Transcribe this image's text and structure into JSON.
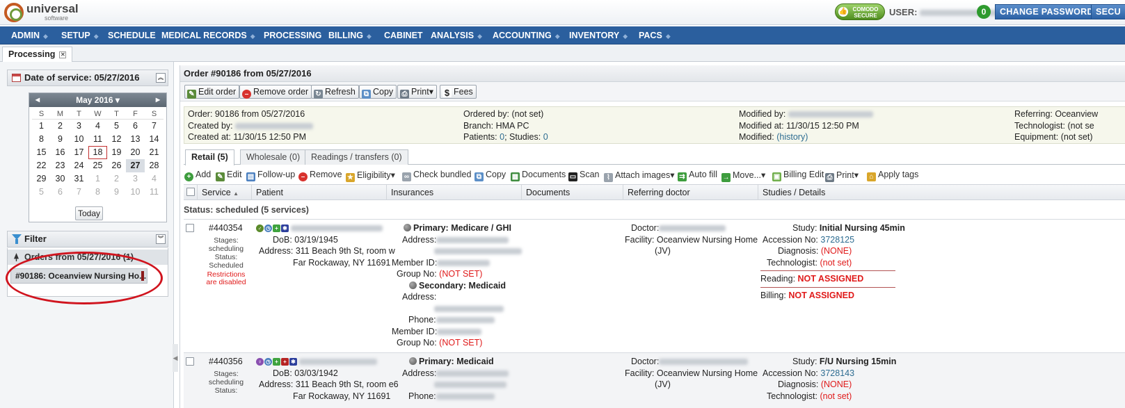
{
  "app": {
    "logo_main": "universal",
    "logo_sub": "software"
  },
  "topbar": {
    "comodo_line1": "COMODO",
    "comodo_line2": "SECURE",
    "user_label": "USER:",
    "notif_count": "0",
    "change_password": "CHANGE PASSWORD",
    "secu": "SECU"
  },
  "menu": [
    {
      "label": "ADMIN",
      "dropdown": true
    },
    {
      "label": "SETUP",
      "dropdown": true
    },
    {
      "label": "SCHEDULE",
      "dropdown": false
    },
    {
      "label": "MEDICAL RECORDS",
      "dropdown": true
    },
    {
      "label": "PROCESSING",
      "dropdown": false
    },
    {
      "label": "BILLING",
      "dropdown": true
    },
    {
      "label": "CABINET",
      "dropdown": false
    },
    {
      "label": "ANALYSIS",
      "dropdown": true
    },
    {
      "label": "ACCOUNTING",
      "dropdown": true
    },
    {
      "label": "INVENTORY",
      "dropdown": true
    },
    {
      "label": "PACS",
      "dropdown": true
    }
  ],
  "page_tab": "Processing",
  "left": {
    "date_of_service": "Date of service: 05/27/2016",
    "calendar": {
      "month": "May 2016 ▾",
      "dow": [
        "S",
        "M",
        "T",
        "W",
        "T",
        "F",
        "S"
      ],
      "weeks": [
        [
          "1",
          "2",
          "3",
          "4",
          "5",
          "6",
          "7"
        ],
        [
          "8",
          "9",
          "10",
          "11",
          "12",
          "13",
          "14"
        ],
        [
          "15",
          "16",
          "17",
          "18",
          "19",
          "20",
          "21"
        ],
        [
          "22",
          "23",
          "24",
          "25",
          "26",
          "27",
          "28"
        ],
        [
          "29",
          "30",
          "31",
          "1",
          "2",
          "3",
          "4"
        ],
        [
          "5",
          "6",
          "7",
          "8",
          "9",
          "10",
          "11"
        ]
      ],
      "today_day": "18",
      "selected_day": "27",
      "today_button": "Today"
    },
    "filter": "Filter",
    "orders_header": "Orders from 05/27/2016 (1)",
    "order_item": "#90186: Oceanview Nursing Ho..."
  },
  "order": {
    "title": "Order #90186 from 05/27/2016",
    "toolbar": [
      "Edit order",
      "Remove order",
      "Refresh",
      "Copy",
      "Print",
      "Fees"
    ],
    "info": {
      "col1": {
        "order_label": "Order:",
        "order_value": "90186 from 05/27/2016",
        "created_by_label": "Created by:",
        "created_at_label": "Created at:",
        "created_at_value": "11/30/15 12:50 PM"
      },
      "col2": {
        "ordered_by_label": "Ordered by:",
        "ordered_by_value": "(not set)",
        "branch_label": "Branch:",
        "branch_value": "HMA PC",
        "patients_label": "Patients:",
        "patients_value": "0",
        "studies_label": "; Studies:",
        "studies_value": "0"
      },
      "col3": {
        "modified_by_label": "Modified by:",
        "modified_at_label": "Modified at:",
        "modified_at_value": "11/30/15 12:50 PM",
        "modified_label": "Modified:",
        "modified_value": "(history)"
      },
      "col4": {
        "referring_label": "Referring:",
        "referring_value": "Oceanview",
        "technologist_label": "Technologist:",
        "technologist_value": "(not se",
        "equipment_label": "Equipment:",
        "equipment_value": "(not set)"
      }
    },
    "tabs": [
      "Retail (5)",
      "Wholesale (0)",
      "Readings / transfers (0)"
    ],
    "actions": [
      "Add",
      "Edit",
      "Follow-up",
      "Remove",
      "Eligibility",
      "Check bundled",
      "Copy",
      "Documents",
      "Scan",
      "Attach images",
      "Auto fill",
      "Move...",
      "Billing Edit",
      "Print",
      "Apply tags"
    ],
    "columns": [
      "Service",
      "Patient",
      "Insurances",
      "Documents",
      "Referring doctor",
      "Studies / Details"
    ],
    "status_group": "Status: scheduled (5 services)",
    "rows": [
      {
        "id": "#440354",
        "stages_label": "Stages:",
        "stages_value": "scheduling",
        "status_label": "Status:",
        "status_value": "Scheduled",
        "restrictions": "Restrictions are disabled",
        "dob_label": "DoB:",
        "dob": "03/19/1945",
        "address_label": "Address:",
        "address1": "311 Beach 9th St, room w",
        "address2": "Far Rockaway, NY 11691",
        "primary": "Primary: Medicare / GHI",
        "ins_address_label": "Address:",
        "member_label": "Member ID:",
        "group_label": "Group No:",
        "group_value": "(NOT SET)",
        "secondary": "Secondary: Medicaid",
        "sec_address_label": "Address:",
        "phone_label": "Phone:",
        "sec_member_label": "Member ID:",
        "sec_group_label": "Group No:",
        "sec_group_value": "(NOT SET)",
        "doctor_label": "Doctor:",
        "facility_label": "Facility:",
        "facility_value": "Oceanview Nursing Home",
        "facility_value2": "(JV)",
        "study_label": "Study:",
        "study_value": "Initial Nursing 45min",
        "accession_label": "Accession No:",
        "accession_value": "3728125",
        "diagnosis_label": "Diagnosis:",
        "diagnosis_value": "(NONE)",
        "technologist_label": "Technologist:",
        "technologist_value": "(not set)",
        "reading_label": "Reading:",
        "reading_value": "NOT ASSIGNED",
        "billing_label": "Billing:",
        "billing_value": "NOT ASSIGNED"
      },
      {
        "id": "#440356",
        "stages_label": "Stages:",
        "stages_value": "scheduling",
        "status_label": "Status:",
        "dob_label": "DoB:",
        "dob": "03/03/1942",
        "address_label": "Address:",
        "address1": "311 Beach 9th St, room e6",
        "address2": "Far Rockaway, NY 11691",
        "primary": "Primary: Medicaid",
        "ins_address_label": "Address:",
        "phone_label": "Phone:",
        "doctor_label": "Doctor:",
        "facility_label": "Facility:",
        "facility_value": "Oceanview Nursing Home",
        "facility_value2": "(JV)",
        "study_label": "Study:",
        "study_value": "F/U Nursing 15min",
        "accession_label": "Accession No:",
        "accession_value": "3728143",
        "diagnosis_label": "Diagnosis:",
        "diagnosis_value": "(NONE)",
        "technologist_label": "Technologist:",
        "technologist_value": "(not set)"
      }
    ]
  },
  "colors": {
    "menu_bg": "#2b5f9e",
    "accent_red": "#e01a1a",
    "link": "#2d6c91",
    "highlight_circle": "#d0141e"
  }
}
